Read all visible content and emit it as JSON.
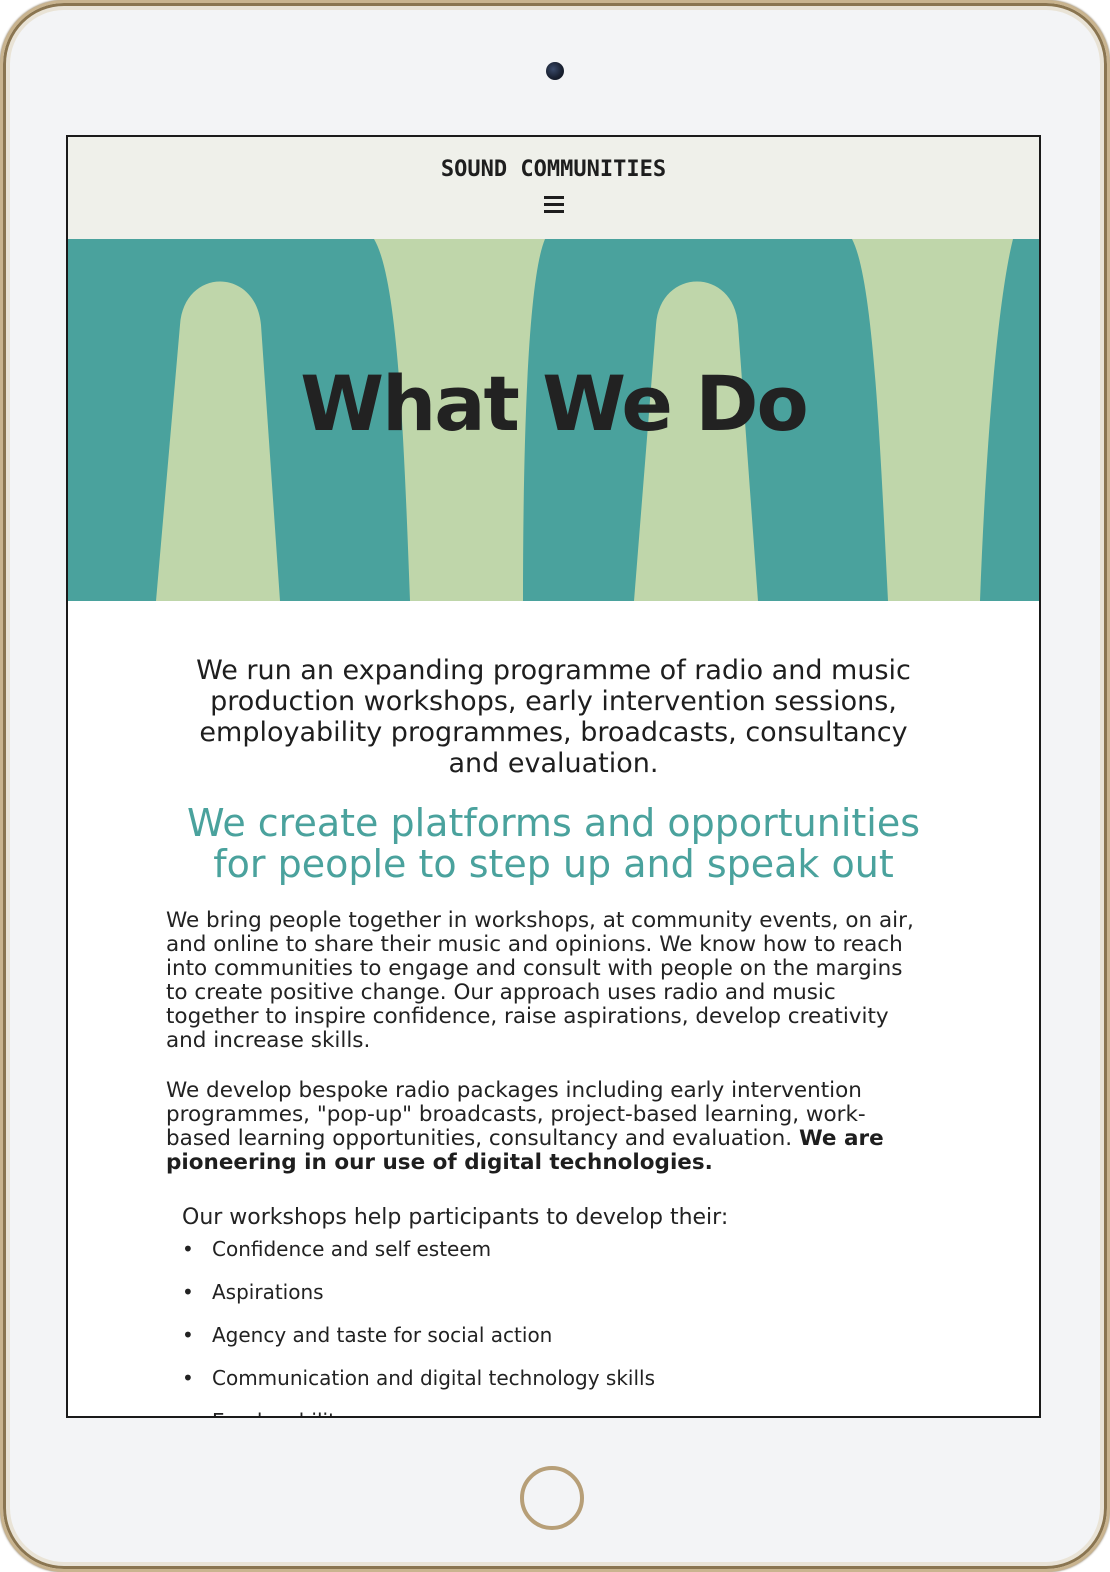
{
  "site": {
    "logo": "SOUND COMMUNITIES",
    "menu_icon": "hamburger-menu-icon"
  },
  "hero": {
    "title": "What We Do",
    "colors": {
      "background": "#4aa29d",
      "shapes": "#bfd6aa"
    }
  },
  "main": {
    "intro": "We run an expanding programme of radio and music production workshops, early intervention sessions, employability programmes, broadcasts, consultancy and evaluation.",
    "tagline": "We create platforms and opportunities for people to step up and speak out",
    "paragraph_1": "We bring people together in workshops, at community events, on air, and online to share their music and opinions. We know how to reach into communities to engage and consult with people on the margins to create positive change. Our approach uses radio and music together to inspire confidence, raise aspirations, develop creativity and increase skills.",
    "paragraph_2_plain": "We develop bespoke radio packages including early intervention programmes, \"pop-up\" broadcasts, project-based learning, work-based learning opportunities, consultancy and evaluation. ",
    "paragraph_2_bold": "We are pioneering in our use of digital technologies.",
    "list_intro": "Our workshops help participants to develop their:",
    "skills": [
      "Confidence and self esteem",
      "Aspirations",
      "Agency and taste for social action",
      "Communication and digital technology skills",
      "Employability"
    ]
  },
  "colors": {
    "accent": "#4aa29d",
    "header_bg": "#eff0ea",
    "text": "#222222"
  }
}
